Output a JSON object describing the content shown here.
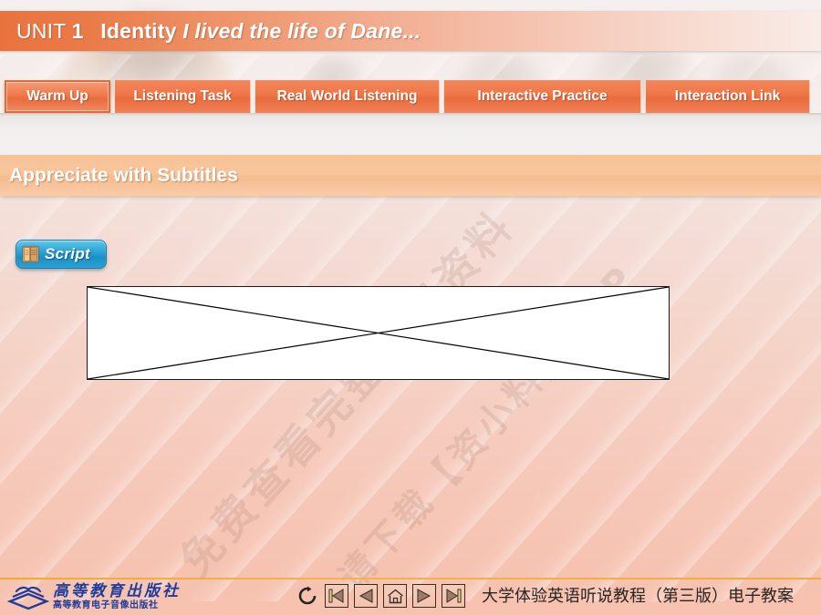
{
  "header": {
    "unit_label": "UNIT",
    "unit_number": "1",
    "topic": "Identity",
    "subtitle": "I lived the life of Dane..."
  },
  "tabs": [
    {
      "label": "Warm Up",
      "active": true
    },
    {
      "label": "Listening Task",
      "active": false
    },
    {
      "label": "Real World Listening",
      "active": false
    },
    {
      "label": "Interactive Practice",
      "active": false
    },
    {
      "label": "Interaction Link",
      "active": false
    }
  ],
  "section": {
    "title": "Appreciate with Subtitles"
  },
  "content": {
    "script_button": {
      "label": "Script",
      "icon": "book-icon"
    },
    "media_placeholder": {
      "state": "broken-image"
    }
  },
  "watermark": {
    "line1": "免费查看完整学习资料",
    "line2": "请下载【资小料】APP"
  },
  "footer": {
    "publisher_main": "高等教育出版社",
    "publisher_sub": "高等教育电子音像出版社",
    "course_title": "大学体验英语听说教程（第三版）电子教案",
    "nav": [
      {
        "name": "replay-icon",
        "label": "Replay"
      },
      {
        "name": "first-slide-icon",
        "label": "First"
      },
      {
        "name": "previous-slide-icon",
        "label": "Previous"
      },
      {
        "name": "home-icon",
        "label": "Home"
      },
      {
        "name": "next-slide-icon",
        "label": "Next"
      },
      {
        "name": "last-slide-icon",
        "label": "Last"
      }
    ]
  },
  "colors": {
    "title_accent": "#e9733f",
    "tab_orange": "#ef7646",
    "section_peach": "#f7c296",
    "script_blue": "#1b8fc6",
    "footer_rule": "#f2a836",
    "logo_blue": "#1f3c9b"
  }
}
